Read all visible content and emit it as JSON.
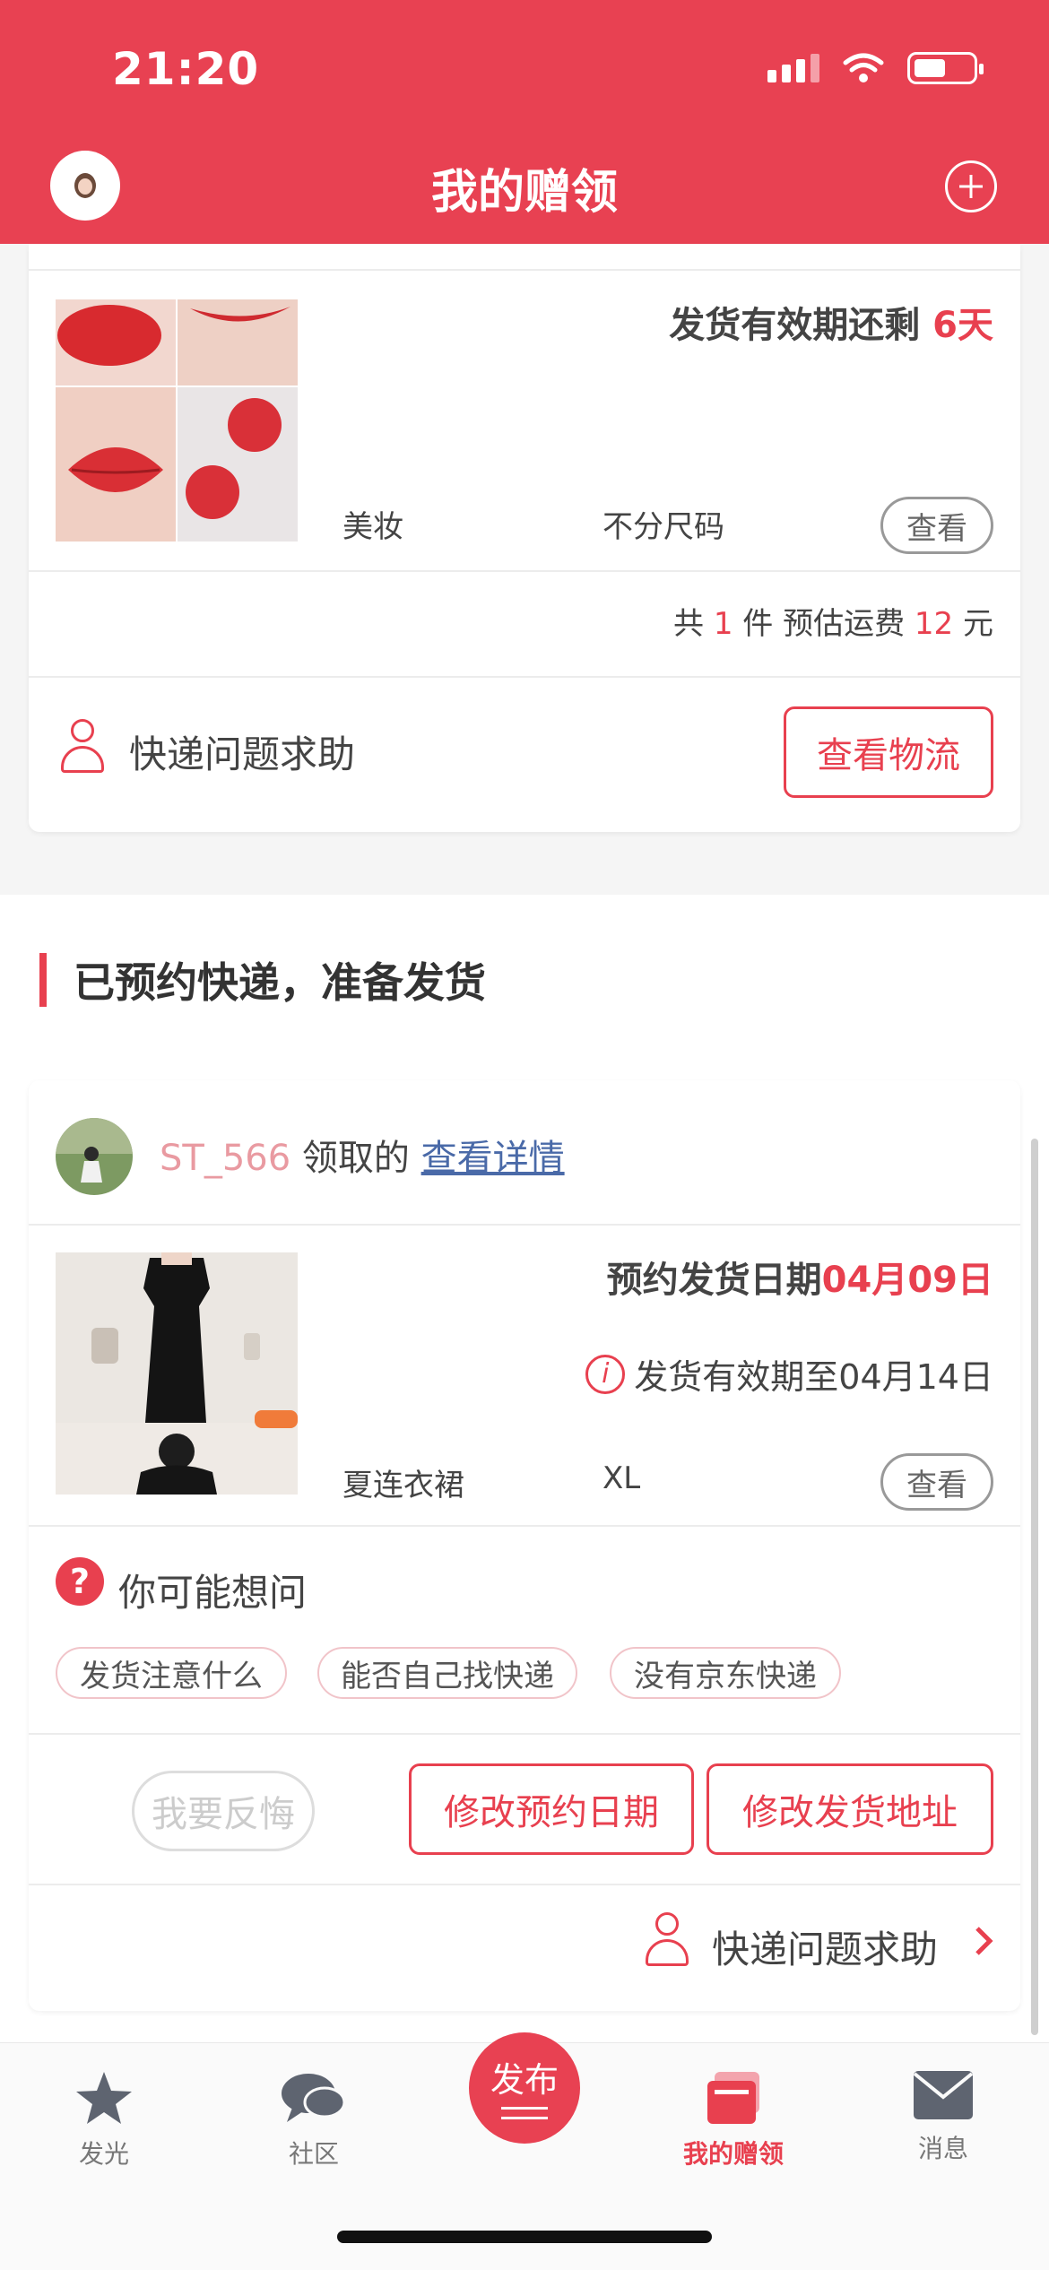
{
  "status": {
    "time": "21:20"
  },
  "header": {
    "title": "我的赠领",
    "add_icon": "plus-circle-icon"
  },
  "card1": {
    "validity_prefix": "发货有效期还剩",
    "validity_days": "6天",
    "category": "美妆",
    "size": "不分尺码",
    "view_label": "查看",
    "summary": {
      "prefix": "共",
      "count": "1",
      "unit": "件 预估运费",
      "fee": "12",
      "currency": "元"
    },
    "help_label": "快递问题求助",
    "logistics_label": "查看物流"
  },
  "section": {
    "title": "已预约快递，准备发货"
  },
  "card2": {
    "username": "ST_566",
    "claimed_text": "领取的",
    "detail_link": "查看详情",
    "reserve_prefix": "预约发货日期",
    "reserve_date": "04月09日",
    "validity_text": "发货有效期至04月14日",
    "category": "夏连衣裙",
    "size": "XL",
    "view_label": "查看",
    "faq_title": "你可能想问",
    "tags": [
      "发货注意什么",
      "能否自己找快递",
      "没有京东快递"
    ],
    "regret_label": "我要反悔",
    "change_date_label": "修改预约日期",
    "change_address_label": "修改发货地址",
    "help_label": "快递问题求助"
  },
  "tabbar": {
    "tabs": [
      {
        "label": "发光",
        "icon": "star-icon"
      },
      {
        "label": "社区",
        "icon": "chat-bubble-icon"
      },
      {
        "label": "发布",
        "icon": "publish-icon"
      },
      {
        "label": "我的赠领",
        "icon": "gift-cards-icon"
      },
      {
        "label": "消息",
        "icon": "envelope-icon"
      }
    ]
  },
  "colors": {
    "brand": "#e84152",
    "accent_text": "#e8404f",
    "link": "#4a6aa8",
    "username": "#e99aa1"
  }
}
